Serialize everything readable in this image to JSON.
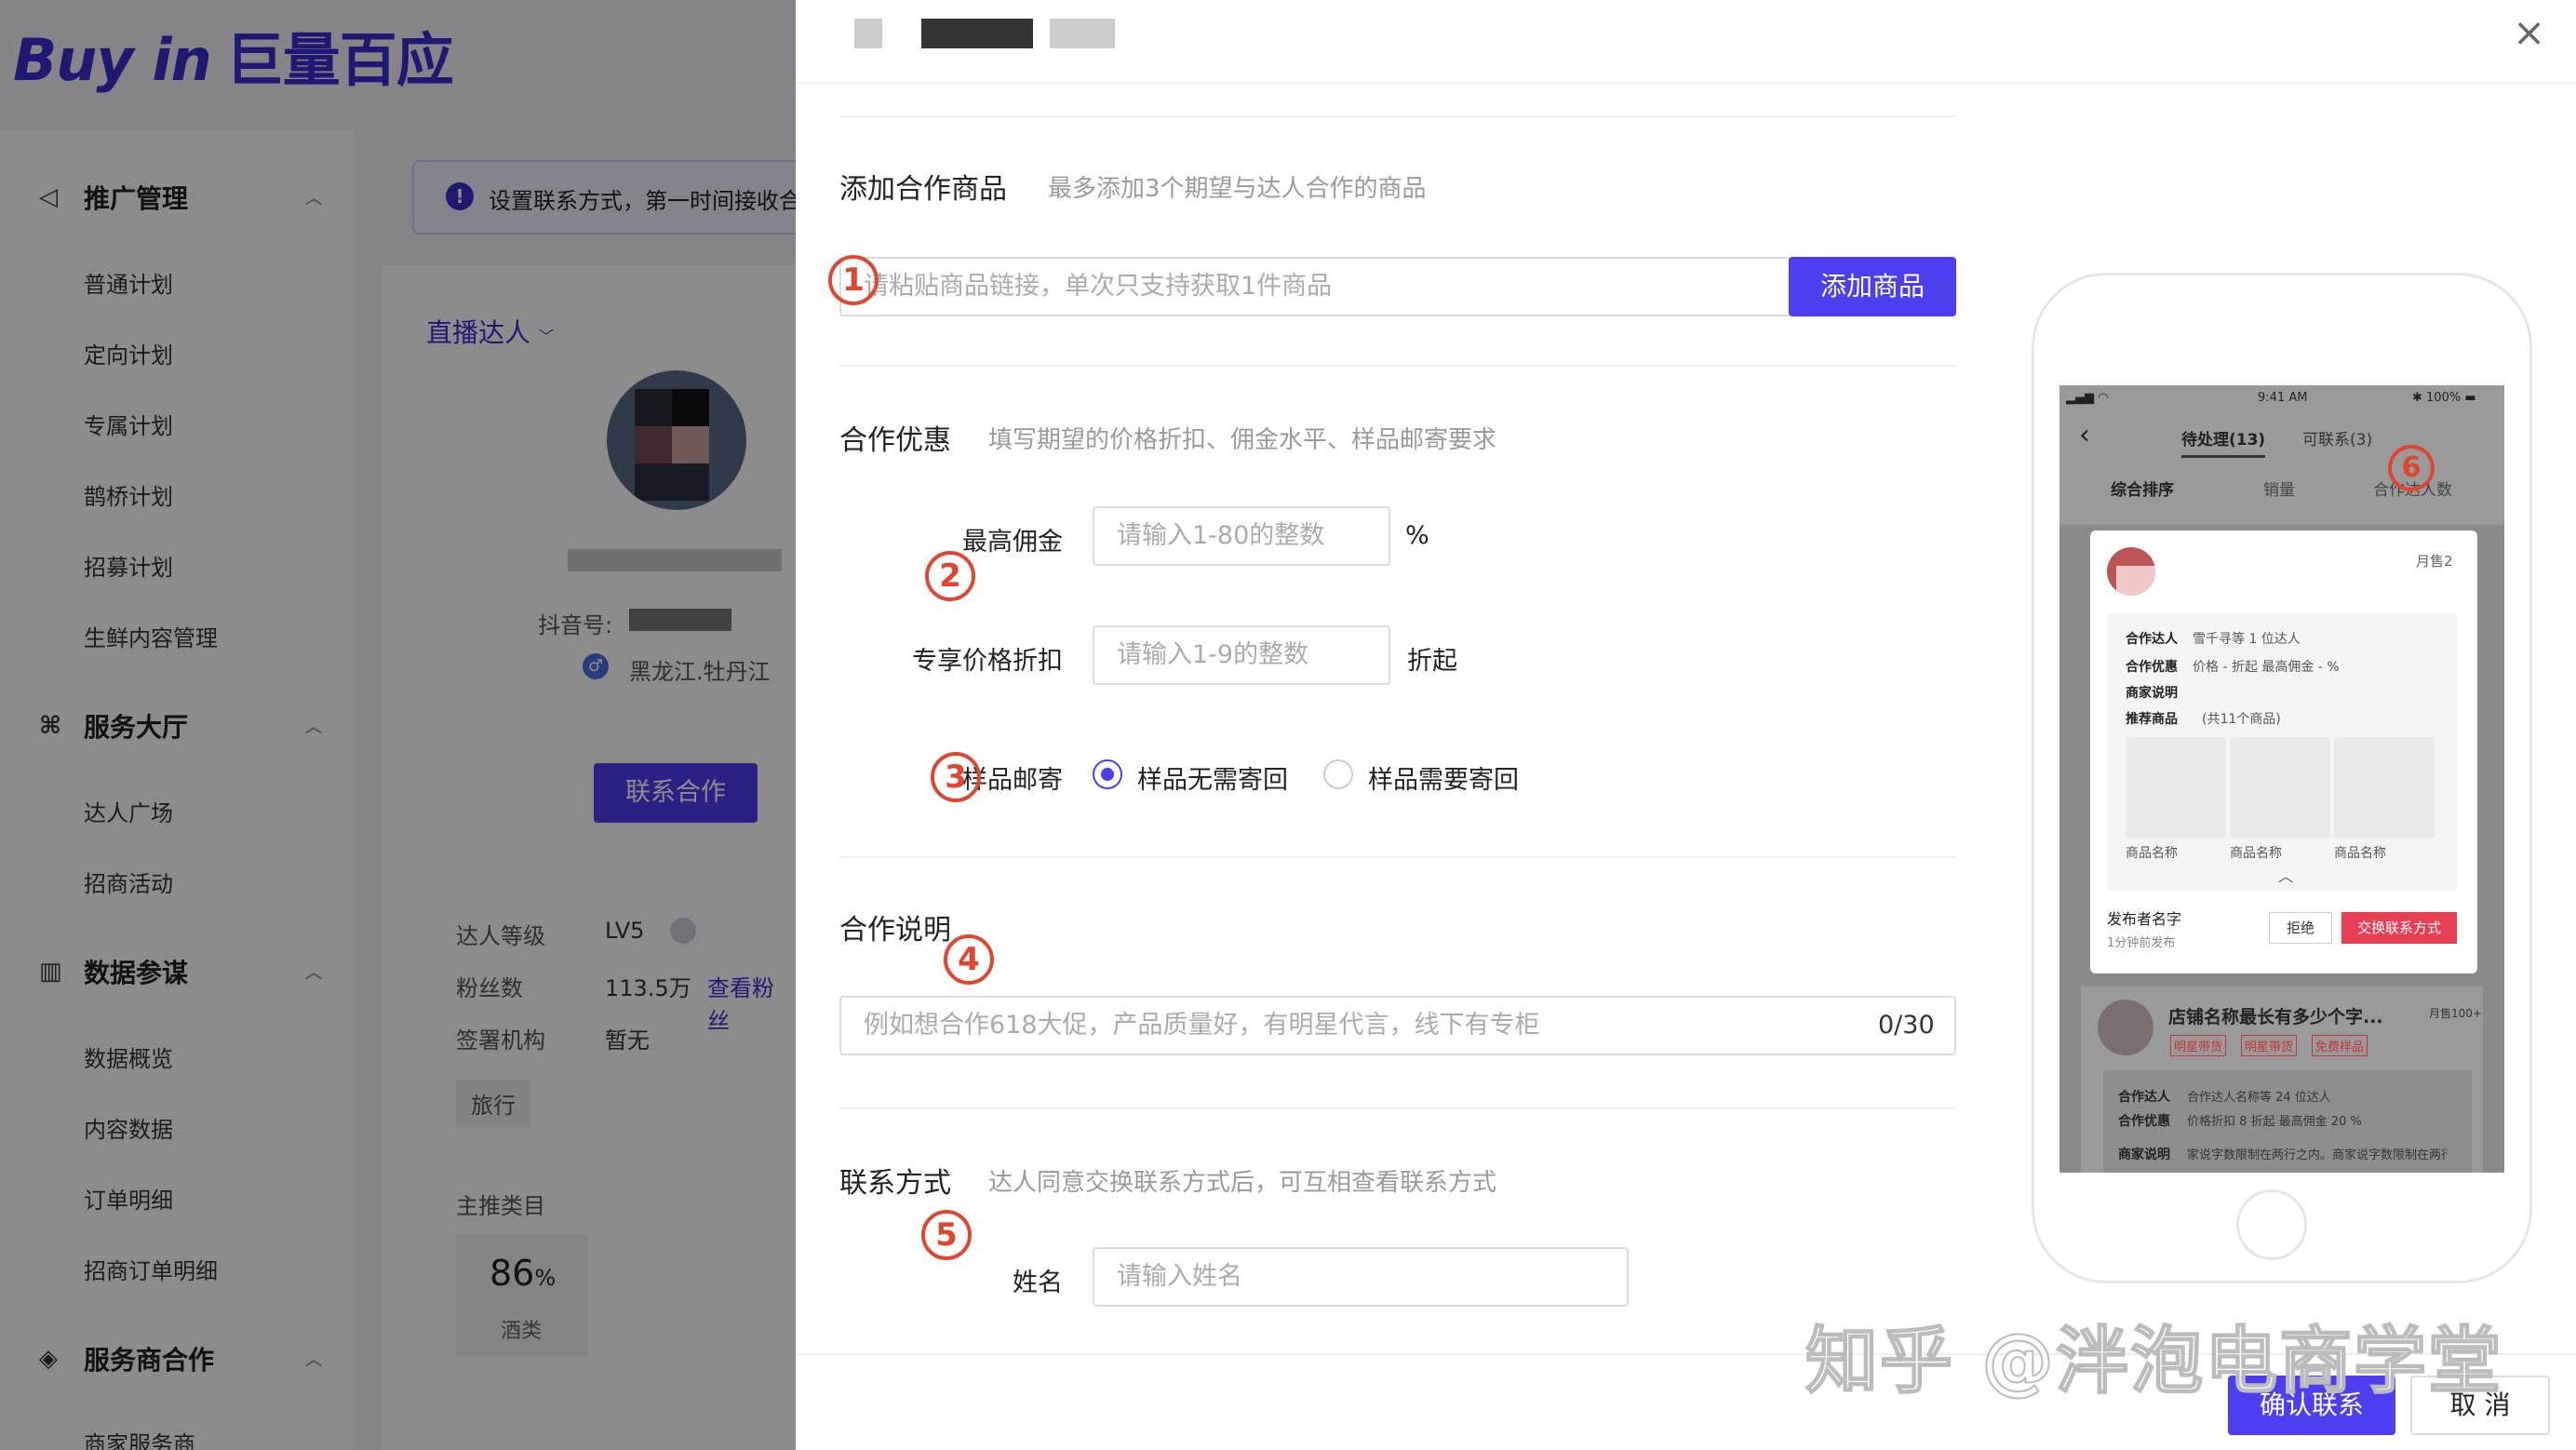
{
  "app": {
    "logo_en": "Buy in",
    "logo_cn": "巨量百应",
    "sidebar": {
      "sections": [
        {
          "title": "推广管理",
          "icon": "megaphone-icon",
          "items": [
            "普通计划",
            "定向计划",
            "专属计划",
            "鹊桥计划",
            "招募计划",
            "生鲜内容管理"
          ]
        },
        {
          "title": "服务大厅",
          "icon": "grid-icon",
          "items": [
            "达人广场",
            "招商活动"
          ]
        },
        {
          "title": "数据参谋",
          "icon": "chart-icon",
          "items": [
            "数据概览",
            "内容数据",
            "订单明细",
            "招商订单明细"
          ]
        },
        {
          "title": "服务商合作",
          "icon": "handshake-icon",
          "items": [
            "商家服务商"
          ]
        }
      ]
    },
    "notice": "设置联系方式，第一时间接收合",
    "profile": {
      "tab": "直播达人",
      "douyin_label": "抖音号:",
      "location": "黑龙江.牡丹江",
      "contact_button": "联系合作",
      "stats": [
        {
          "label": "达人等级",
          "value": "LV5"
        },
        {
          "label": "粉丝数",
          "value": "113.5万",
          "link": "查看粉丝"
        },
        {
          "label": "签署机构",
          "value": "暂无"
        }
      ],
      "tag": "旅行",
      "category_label": "主推类目",
      "category_percent": "86",
      "category_unit": "%",
      "category_name": "酒类"
    }
  },
  "modal": {
    "close_icon": "×",
    "product": {
      "title": "添加合作商品",
      "hint": "最多添加3个期望与达人合作的商品",
      "placeholder": "请粘贴商品链接，单次只支持获取1件商品",
      "button": "添加商品"
    },
    "offer": {
      "title": "合作优惠",
      "hint": "填写期望的价格折扣、佣金水平、样品邮寄要求",
      "commission_label": "最高佣金",
      "commission_placeholder": "请输入1-80的整数",
      "commission_unit": "%",
      "discount_label": "专享价格折扣",
      "discount_placeholder": "请输入1-9的整数",
      "discount_unit": "折起",
      "sample_label": "样品邮寄",
      "sample_options": [
        "样品无需寄回",
        "样品需要寄回"
      ],
      "sample_selected": 0
    },
    "note": {
      "title": "合作说明",
      "placeholder": "例如想合作618大促，产品质量好，有明星代言，线下有专柜",
      "counter": "0/30"
    },
    "contact": {
      "title": "联系方式",
      "hint": "达人同意交换联系方式后，可互相查看联系方式",
      "name_label": "姓名",
      "name_placeholder": "请输入姓名"
    },
    "footer": {
      "confirm": "确认联系",
      "cancel": "取 消"
    },
    "markers": [
      "1",
      "2",
      "3",
      "4",
      "5",
      "6"
    ]
  },
  "phone": {
    "time": "9:41 AM",
    "battery": "100%",
    "tabs": [
      "待处理(13)",
      "可联系(3)"
    ],
    "sorts": [
      "综合排序",
      "销量",
      "合作达人数"
    ],
    "card": {
      "monthly": "月售2",
      "rows": [
        {
          "k": "合作达人",
          "v": "雪千寻等 1 位达人"
        },
        {
          "k": "合作优惠",
          "v": "价格 - 折起 最高佣金 - %"
        },
        {
          "k": "商家说明",
          "v": ""
        },
        {
          "k": "推荐商品",
          "v": "(共11个商品)"
        }
      ],
      "product_names": [
        "商品名称",
        "商品名称",
        "商品名称"
      ],
      "publisher": "发布者名字",
      "published_time": "1分钟前发布",
      "reject": "拒绝",
      "exchange": "交换联系方式"
    },
    "card2": {
      "shop": "店铺名称最长有多少个字...",
      "monthly": "月售100+",
      "tags": [
        "明星带货",
        "明星带货",
        "免费样品"
      ],
      "rows": [
        {
          "k": "合作达人",
          "v": "合作达人名称等 24 位达人"
        },
        {
          "k": "合作优惠",
          "v": "价格折扣 8 折起  最高佣金 20 %"
        },
        {
          "k": "商家说明",
          "v": "家说字数限制在两行之内。商家说字数限制在两行之内"
        }
      ]
    }
  },
  "watermark": "知乎 @泮泡电商学堂"
}
